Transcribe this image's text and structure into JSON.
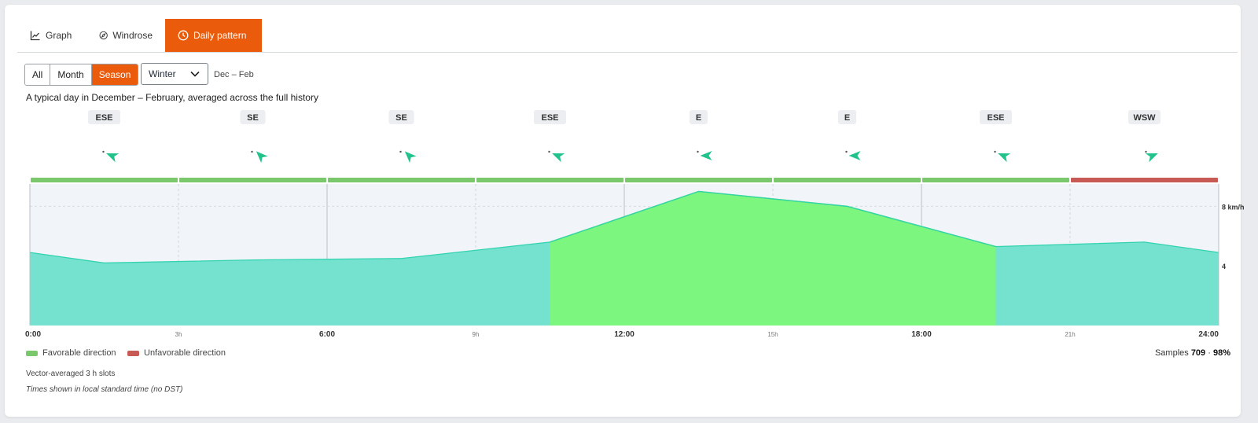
{
  "tabs": [
    {
      "label": "Graph",
      "icon": "chart-line-icon",
      "active": false
    },
    {
      "label": "Windrose",
      "icon": "compass-icon",
      "active": false
    },
    {
      "label": "Daily pattern",
      "icon": "clock-icon",
      "active": true
    }
  ],
  "filters": {
    "segments": [
      {
        "label": "All",
        "active": false
      },
      {
        "label": "Month",
        "active": false
      },
      {
        "label": "Season",
        "active": true
      }
    ],
    "season_select": "Winter",
    "range_label": "Dec – Feb"
  },
  "subtitle": "A typical day in December – February, averaged across the full history",
  "chart_data": {
    "type": "area",
    "x_hours": [
      0,
      1.5,
      4.5,
      7.5,
      10.5,
      13.5,
      16.5,
      19.5,
      22.5,
      24
    ],
    "speed_kmh": [
      4.9,
      4.2,
      4.4,
      4.5,
      5.6,
      9.0,
      8.0,
      5.3,
      5.6,
      4.9
    ],
    "ylim": [
      0,
      9.5
    ],
    "ytick_values": [
      4,
      8
    ],
    "ytick_labels": [
      "4",
      "8 km/h"
    ],
    "xtick_hours": [
      0,
      3,
      6,
      9,
      12,
      15,
      18,
      21,
      24
    ],
    "xtick_labels": [
      "0:00",
      "3h",
      "6:00",
      "9h",
      "12:00",
      "15h",
      "18:00",
      "21h",
      "24:00"
    ],
    "xtick_major": [
      true,
      false,
      true,
      false,
      true,
      false,
      true,
      false,
      true
    ],
    "slots": [
      {
        "start": 0,
        "direction": "ESE",
        "bearing_deg": 112.5,
        "favorable": true,
        "highlight": false
      },
      {
        "start": 3,
        "direction": "SE",
        "bearing_deg": 135,
        "favorable": true,
        "highlight": false
      },
      {
        "start": 6,
        "direction": "SE",
        "bearing_deg": 135,
        "favorable": true,
        "highlight": false
      },
      {
        "start": 9,
        "direction": "ESE",
        "bearing_deg": 112.5,
        "favorable": true,
        "highlight": false
      },
      {
        "start": 12,
        "direction": "E",
        "bearing_deg": 90,
        "favorable": true,
        "highlight": true
      },
      {
        "start": 15,
        "direction": "E",
        "bearing_deg": 90,
        "favorable": true,
        "highlight": true
      },
      {
        "start": 18,
        "direction": "ESE",
        "bearing_deg": 112.5,
        "favorable": true,
        "highlight": false
      },
      {
        "start": 21,
        "direction": "WSW",
        "bearing_deg": 247.5,
        "favorable": false,
        "highlight": false
      }
    ],
    "colors": {
      "area": "#74e2cf",
      "area_line": "#33d3b0",
      "highlight_area": "#7cf67e",
      "highlight_line": "#4fe35a",
      "favorable": "#7bc86c",
      "unfavorable": "#c85a55",
      "arrow": "#22c38a",
      "plot_bg": "#f1f4f8"
    }
  },
  "legend": {
    "favorable": "Favorable direction",
    "unfavorable": "Unfavorable direction"
  },
  "samples": {
    "label": "Samples",
    "count": "709",
    "separator": "·",
    "percent": "98%"
  },
  "notes": {
    "line1": "Vector-averaged 3 h slots",
    "line2": "Times shown in local standard time (no DST)"
  }
}
